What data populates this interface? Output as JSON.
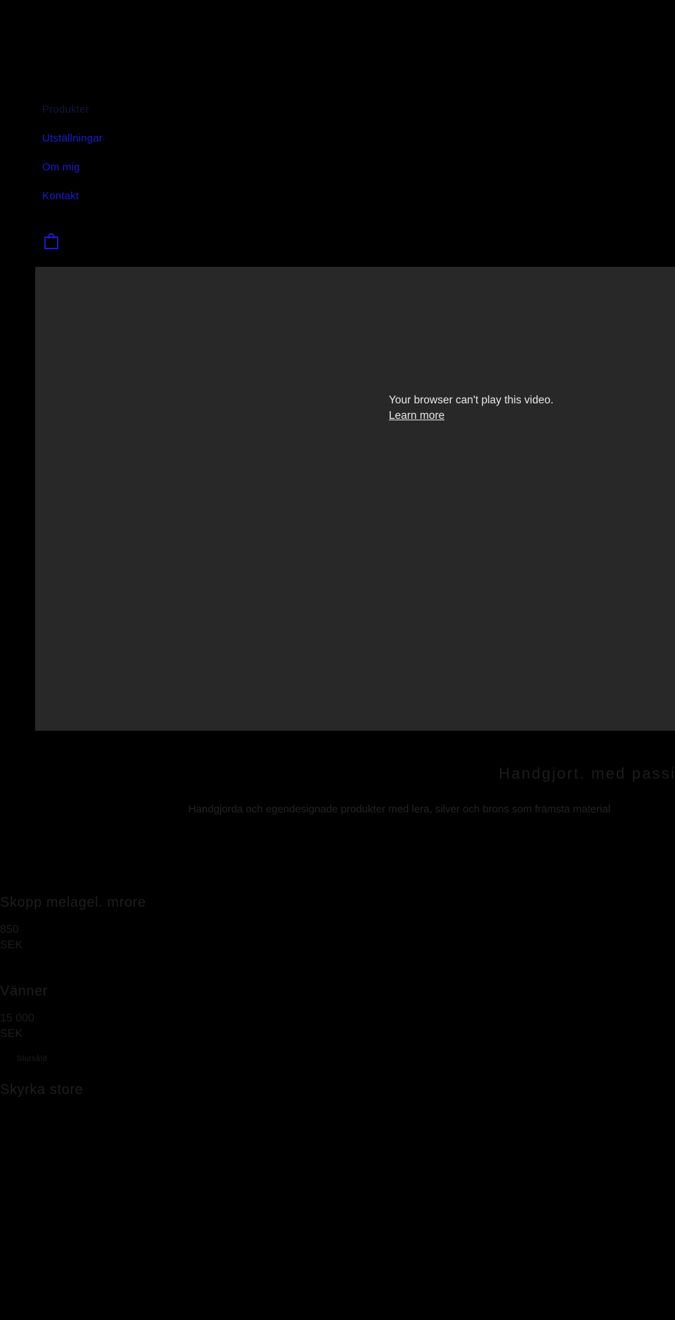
{
  "site": {
    "nav": [
      {
        "label": "Produkter",
        "state": "dim"
      },
      {
        "label": "Utställningar",
        "state": "normal"
      },
      {
        "label": "Om mig",
        "state": "normal"
      },
      {
        "label": "Kontakt",
        "state": "normal"
      }
    ],
    "cart_icon": "shopping-bag-icon",
    "accent_color": "#1b1bd0"
  },
  "video": {
    "error_line": "Your browser can't play this video.",
    "learn_more": "Learn more",
    "play_icon": "play-triangle-icon",
    "background_color": "#282828"
  },
  "hero": {
    "title": "Handgjort. med passion",
    "subtitle": "Handgjorda och egendesignade produkter med lera, silver och brons som främsta material"
  },
  "products": [
    {
      "title": "Skopp melagel. mrore",
      "price": "850",
      "currency": "SEK",
      "badge": null
    },
    {
      "title": "Vänner",
      "price": "15 000",
      "currency": "SEK",
      "badge": null
    },
    {
      "title": "",
      "price": "",
      "currency": "",
      "badge": "Slutsåld"
    },
    {
      "title": "Skyrka store",
      "price": "",
      "currency": "",
      "badge": null
    }
  ]
}
